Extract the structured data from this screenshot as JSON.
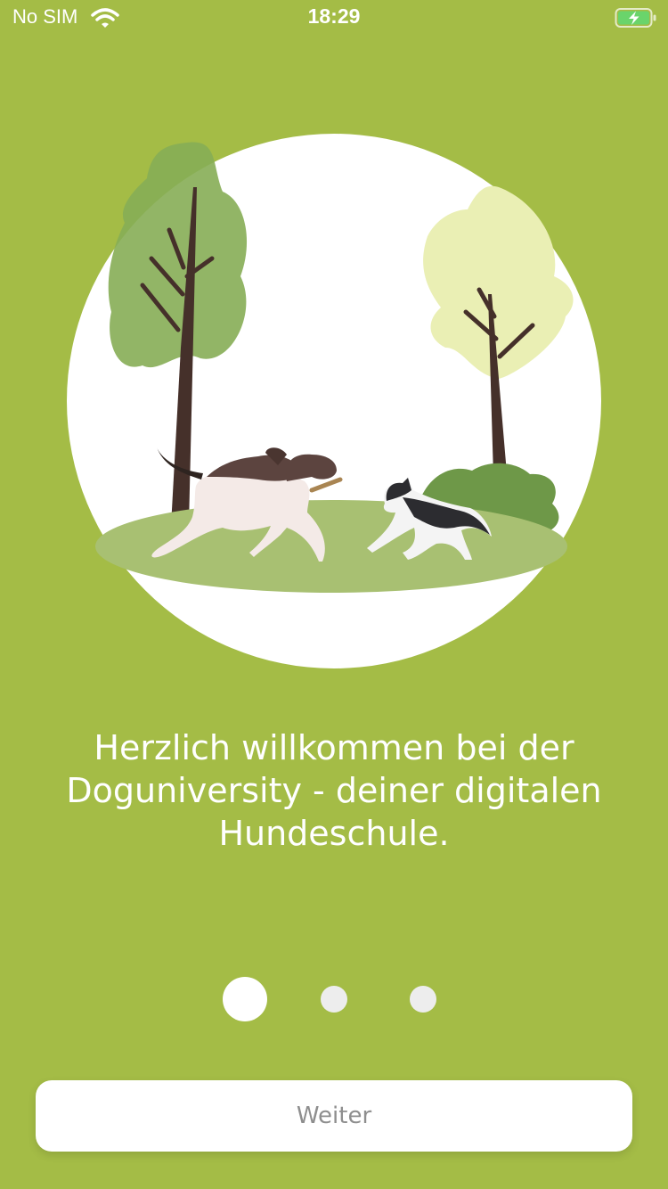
{
  "status_bar": {
    "carrier": "No SIM",
    "time": "18:29",
    "icons": [
      "wifi-icon",
      "battery-charging-icon"
    ]
  },
  "onboarding": {
    "illustration": "dogs-playing-in-park-illustration",
    "welcome_text": "Herzlich willkommen bei der Doguniversity - deiner digitalen Hundeschule.",
    "page_indicator": {
      "current": 1,
      "total": 3
    },
    "next_label": "Weiter"
  },
  "colors": {
    "background": "#A4BC46",
    "accent_white": "#FFFFFF",
    "button_text": "#8E8E8E",
    "dot_inactive": "#EDEDED"
  }
}
